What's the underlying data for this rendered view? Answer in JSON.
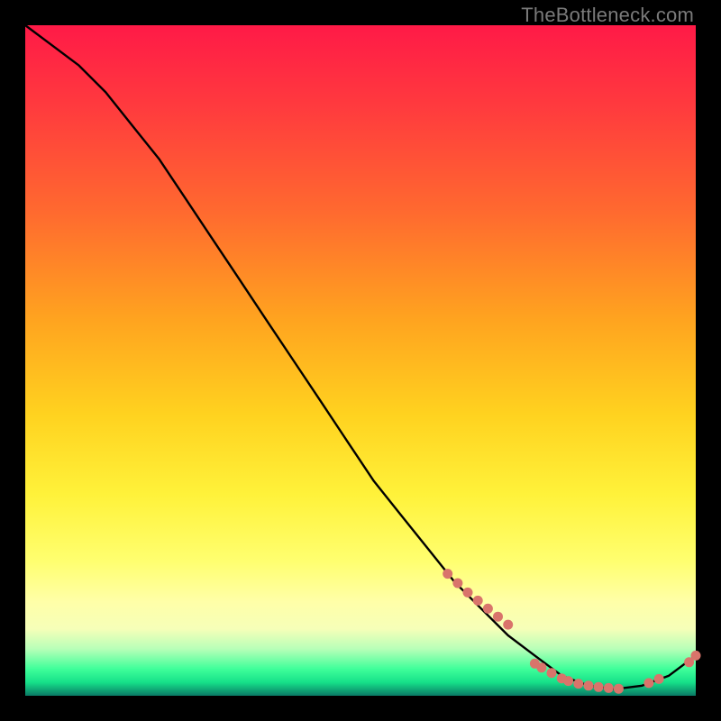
{
  "watermark": "TheBottleneck.com",
  "chart_data": {
    "type": "line",
    "title": "",
    "xlabel": "",
    "ylabel": "",
    "xlim": [
      0,
      100
    ],
    "ylim": [
      0,
      100
    ],
    "grid": false,
    "legend": false,
    "series": [
      {
        "name": "curve",
        "color": "#000000",
        "x": [
          0,
          4,
          8,
          12,
          16,
          20,
          24,
          28,
          32,
          36,
          40,
          44,
          48,
          52,
          56,
          60,
          64,
          68,
          72,
          76,
          80,
          84,
          88,
          92,
          96,
          100
        ],
        "y": [
          100,
          97,
          94,
          90,
          85,
          80,
          74,
          68,
          62,
          56,
          50,
          44,
          38,
          32,
          27,
          22,
          17,
          13,
          9,
          6,
          3,
          1.5,
          1,
          1.5,
          3,
          6
        ]
      },
      {
        "name": "highlight-dots",
        "color": "#d9746b",
        "type": "scatter",
        "x": [
          63,
          64.5,
          66,
          67.5,
          69,
          70.5,
          72,
          76,
          77,
          78.5,
          80,
          81,
          82.5,
          84,
          85.5,
          87,
          88.5,
          93,
          94.5,
          99,
          100
        ],
        "y": [
          18.2,
          16.8,
          15.4,
          14.2,
          13,
          11.8,
          10.6,
          4.8,
          4.2,
          3.4,
          2.6,
          2.2,
          1.8,
          1.5,
          1.3,
          1.15,
          1.05,
          1.9,
          2.5,
          5,
          6
        ]
      }
    ],
    "colors": {
      "gradient_top": "#ff1a47",
      "gradient_mid": "#ffd21f",
      "gradient_low": "#ffff70",
      "gradient_bottom": "#16e089",
      "frame": "#000000",
      "dot": "#d9746b"
    }
  }
}
